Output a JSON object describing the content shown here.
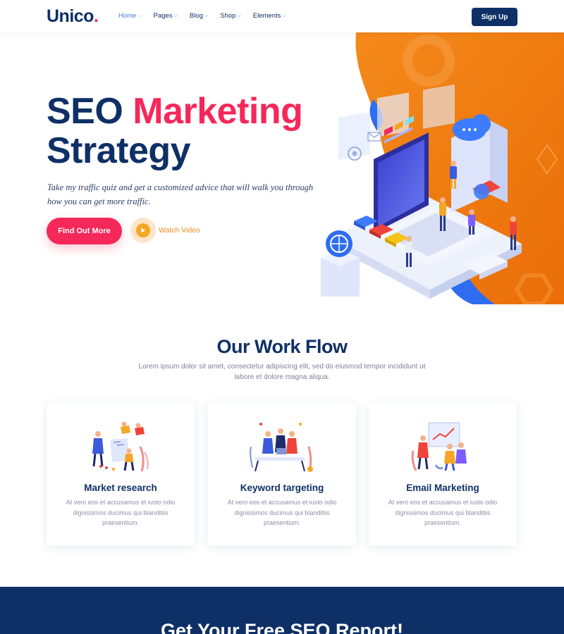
{
  "header": {
    "logo_text": "Unico",
    "logo_dot": ".",
    "nav": [
      {
        "label": "Home"
      },
      {
        "label": "Pages"
      },
      {
        "label": "Blog"
      },
      {
        "label": "Shop"
      },
      {
        "label": "Elements"
      }
    ],
    "signup_label": "Sign Up"
  },
  "hero": {
    "title_part1": "SEO",
    "title_accent": "Marketing",
    "title_line2": "Strategy",
    "subtitle": "Take my traffic quiz and get a customized advice that will walk you through how you can get more traffic.",
    "cta_label": "Find Out More",
    "watch_label": "Watch Video"
  },
  "workflow": {
    "title": "Our Work Flow",
    "subtitle": "Lorem ipsum dolor sit amet, consectetur adipiscing elit, sed do eiusmod tempor incididunt ut labore et dolore magna aliqua.",
    "cards": [
      {
        "title": "Market research",
        "text": "At vero eos et accusamus et iusto odio dignissimos ducimus qui blanditiis praesentium."
      },
      {
        "title": "Keyword targeting",
        "text": "At vero eos et accusamus et iusto odio dignissimos ducimus qui blanditiis praesentium."
      },
      {
        "title": "Email Marketing",
        "text": "At vero eos et accusamus et iusto odio dignissimos ducimus qui blanditiis praesentium."
      }
    ]
  },
  "band": {
    "title": "Get Your Free SEO Report!"
  },
  "colors": {
    "navy": "#0f3066",
    "accent_pink": "#f5285a",
    "orange": "#f07a12",
    "blue": "#2f6df0",
    "nav_active": "#4a78d9"
  },
  "icons": [
    "play-icon",
    "chevron-down-icon",
    "cloud-icon",
    "globe-icon",
    "at-icon",
    "mail-icon"
  ]
}
